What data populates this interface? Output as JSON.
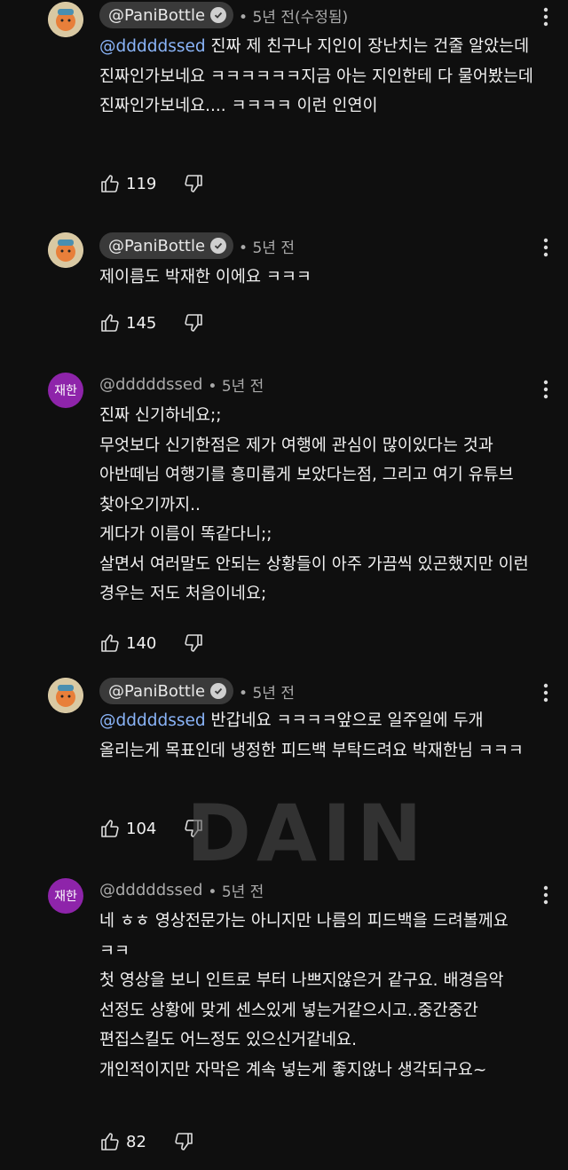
{
  "comments": [
    {
      "handle": "@PaniBottle",
      "time": "• 5년 전(수정됨)",
      "mention": "@dddddssed",
      "text": " 진짜 제 친구나 지인이 장난치는 건줄 알았는데 진짜인가보네요 ㅋㅋㅋㅋㅋㅋ지금 아는 지인한테 다 물어봤는데 진짜인가보네요.... ㅋㅋㅋㅋ 이런 인연이",
      "likes": "119"
    },
    {
      "handle": "@PaniBottle",
      "time": "• 5년 전",
      "mention": "",
      "text": "제이름도 박재한 이에요 ㅋㅋㅋ",
      "likes": "145"
    },
    {
      "avatar_text": "재한",
      "handle": "@dddddssed",
      "time": "• 5년 전",
      "mention": "",
      "text": "진짜 신기하네요;;\n무엇보다 신기한점은 제가 여행에 관심이 많이있다는 것과 아반떼님 여행기를 흥미롭게 보았다는점, 그리고 여기 유튜브 찾아오기까지..\n게다가 이름이 똑같다니;;\n살면서 여러말도 안되는 상황들이 아주 가끔씩 있곤했지만 이런 경우는 저도 처음이네요;",
      "likes": "140"
    },
    {
      "handle": "@PaniBottle",
      "time": "• 5년 전",
      "mention": "@dddddssed",
      "text": " 반갑네요 ㅋㅋㅋㅋ앞으로 일주일에 두개 올리는게 목표인데 냉정한 피드백 부탁드려요 박재한님 ㅋㅋㅋ",
      "likes": "104"
    },
    {
      "avatar_text": "재한",
      "handle": "@dddddssed",
      "time": "• 5년 전",
      "mention": "",
      "text": "네 ㅎㅎ 영상전문가는 아니지만 나름의 피드백을 드려볼께요 ㅋㅋ\n첫 영상을 보니 인트로 부터 나쁘지않은거 같구요. 배경음악 선정도 상황에 맞게 센스있게 넣는거같으시고..중간중간 편집스킬도 어느정도 있으신거같네요.\n개인적이지만 자막은 계속 넣는게 좋지않나 생각되구요~",
      "likes": "82"
    }
  ],
  "watermark": "DAIN",
  "colors": {
    "background": "#0f0f0f",
    "mention": "#8ab4f8",
    "avatar_purple": "#8e24aa",
    "chip": "#3a3a3a"
  },
  "icons": [
    "thumbs-up-icon",
    "thumbs-down-icon",
    "more-vert-icon",
    "verified-check-icon"
  ]
}
